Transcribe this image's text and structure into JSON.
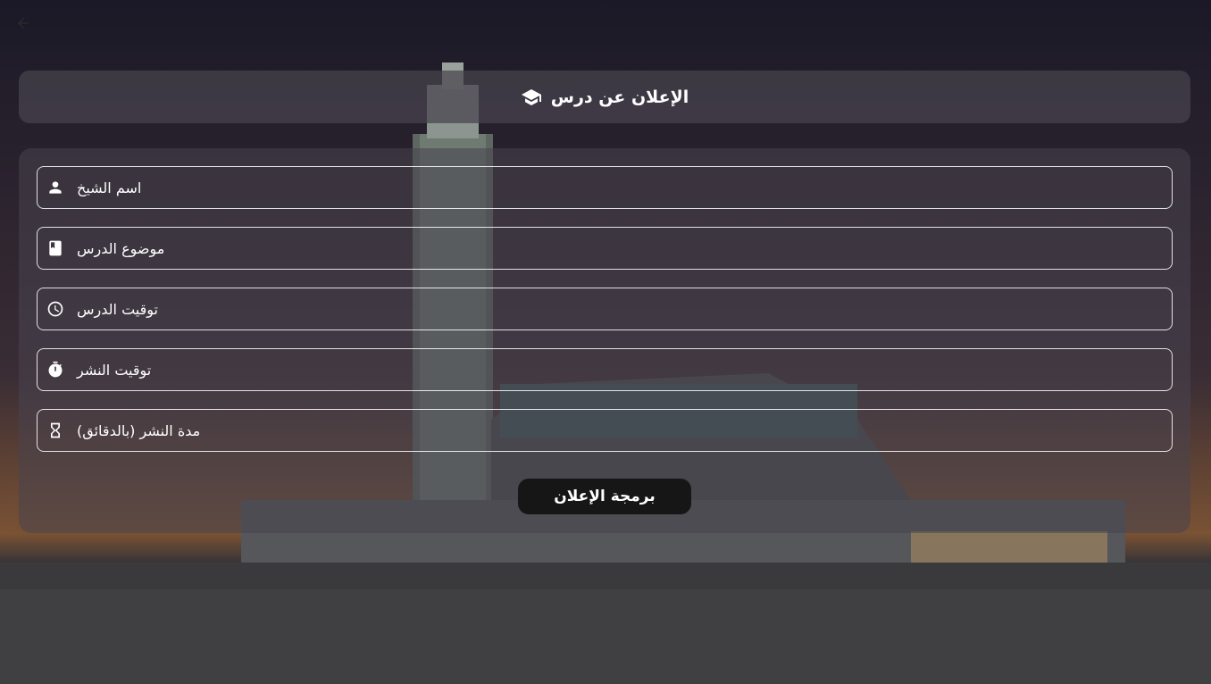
{
  "header": {
    "title": "الإعلان عن درس"
  },
  "form": {
    "fields": [
      {
        "label": "اسم الشيخ",
        "icon": "person-icon"
      },
      {
        "label": "موضوع الدرس",
        "icon": "book-icon"
      },
      {
        "label": "توقيت الدرس",
        "icon": "clock-icon"
      },
      {
        "label": "توقيت النشر",
        "icon": "timer-icon"
      },
      {
        "label": "مدة النشر (بالدقائق)",
        "icon": "hourglass-icon"
      }
    ],
    "submit_label": "برمجة الإعلان"
  },
  "colors": {
    "card_bg": "#48444E",
    "button_bg": "#161616",
    "text": "#FFFFFF"
  }
}
